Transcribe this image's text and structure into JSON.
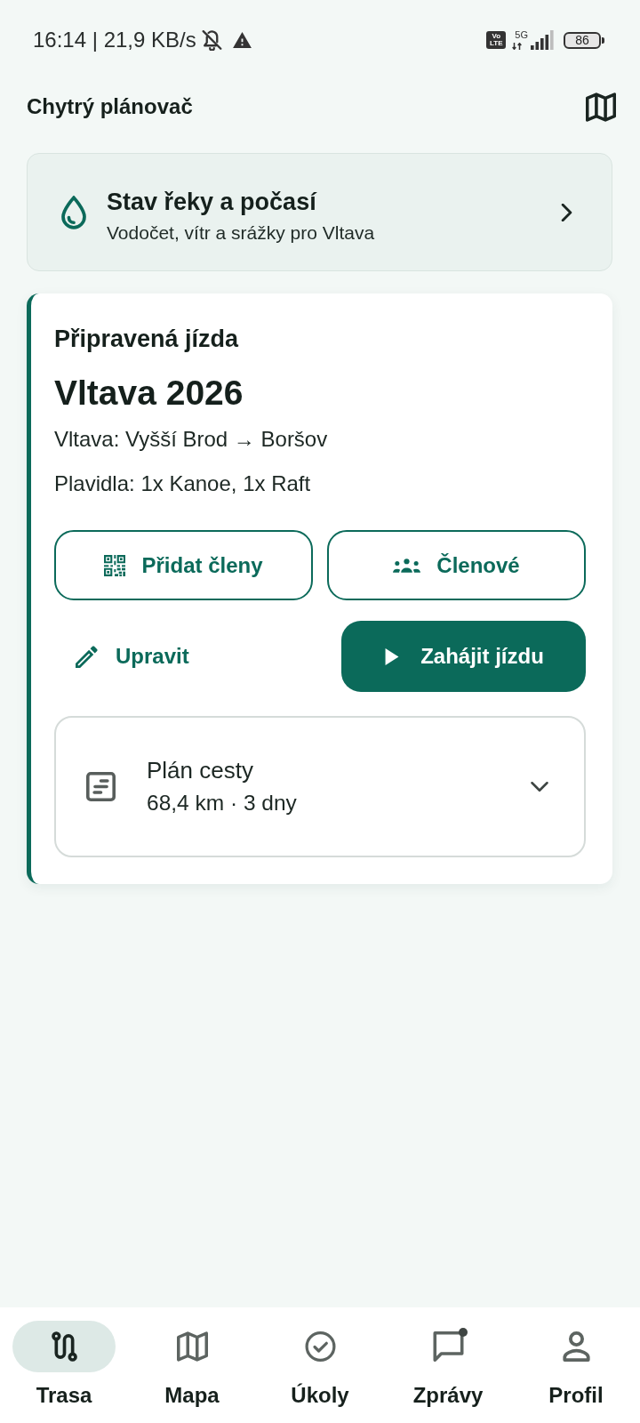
{
  "status_bar": {
    "time_and_speed": "16:14 | 21,9 KB/s",
    "volte": [
      "Vo",
      "LTE"
    ],
    "network_type": "5G",
    "battery": "86"
  },
  "header": {
    "title": "Chytrý plánovač"
  },
  "river_card": {
    "title": "Stav řeky a počasí",
    "subtitle": "Vodočet, vítr a srážky pro Vltava"
  },
  "trip_card": {
    "label": "Připravená jízda",
    "title": "Vltava 2026",
    "route": "Vltava: Vyšší Brod → Boršov",
    "boats": "Plavidla: 1x Kanoe, 1x Raft",
    "member_actions": [
      {
        "label": "Přidat členy",
        "kind": "outlined"
      },
      {
        "label": "Členové",
        "kind": "outlined"
      }
    ],
    "ride_actions": [
      {
        "label": "Upravit",
        "kind": "text"
      },
      {
        "label": "Zahájit jízdu",
        "kind": "filled"
      }
    ],
    "plan": {
      "title": "Plán cesty",
      "summary": "68,4 km · 3 dny",
      "expanded": false
    }
  },
  "nav": [
    {
      "label": "Trasa",
      "selected": true,
      "unread": false
    },
    {
      "label": "Mapa",
      "selected": false,
      "unread": false
    },
    {
      "label": "Úkoly",
      "selected": false,
      "unread": false
    },
    {
      "label": "Zprávy",
      "selected": false,
      "unread": true
    },
    {
      "label": "Profil",
      "selected": false,
      "unread": false
    }
  ]
}
